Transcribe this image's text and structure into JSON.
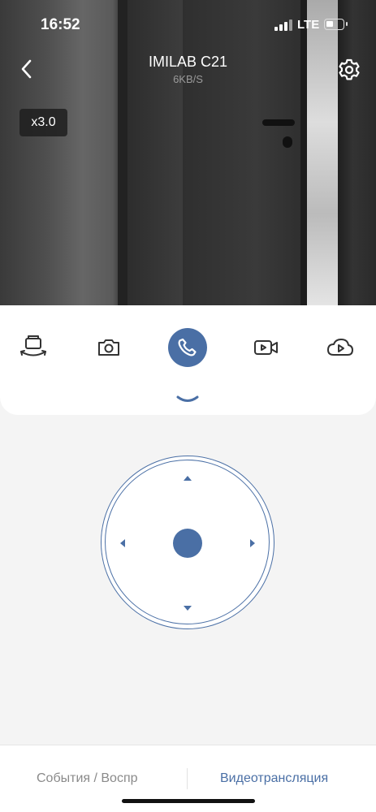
{
  "status_bar": {
    "time": "16:52",
    "network": "LTE"
  },
  "camera": {
    "title": "IMILAB C21",
    "speed": "6KB/S",
    "zoom": "x3.0"
  },
  "icons": {
    "back": "chevron-left-icon",
    "settings": "gear-icon",
    "ptz_calibrate": "camera-rotate-icon",
    "snapshot": "camera-icon",
    "call": "phone-icon",
    "record": "video-camera-icon",
    "cloud": "cloud-play-icon",
    "collapse": "chevron-down-icon"
  },
  "colors": {
    "accent": "#4a6fa5",
    "inactive_tab": "#8a8a8a"
  },
  "tabs": {
    "events": "События / Воспр",
    "live": "Видеотрансляция"
  }
}
